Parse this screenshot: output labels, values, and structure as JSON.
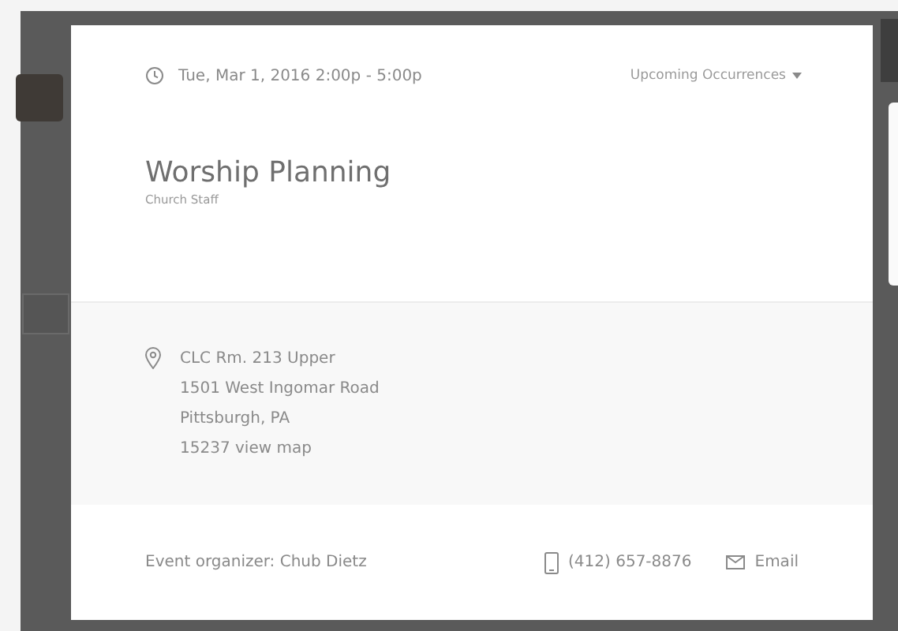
{
  "event": {
    "datetime": "Tue, Mar 1, 2016 2:00p - 5:00p",
    "occurrences_menu": "Upcoming Occurrences",
    "title": "Worship Planning",
    "group": "Church Staff"
  },
  "location": {
    "lines": [
      "CLC Rm. 213 Upper",
      "1501 West Ingomar Road",
      "Pittsburgh, PA",
      "15237"
    ],
    "map_link": "view map"
  },
  "footer": {
    "organizer": "Event organizer: Chub Dietz",
    "phone": "(412) 657-8876",
    "email": "Email"
  }
}
